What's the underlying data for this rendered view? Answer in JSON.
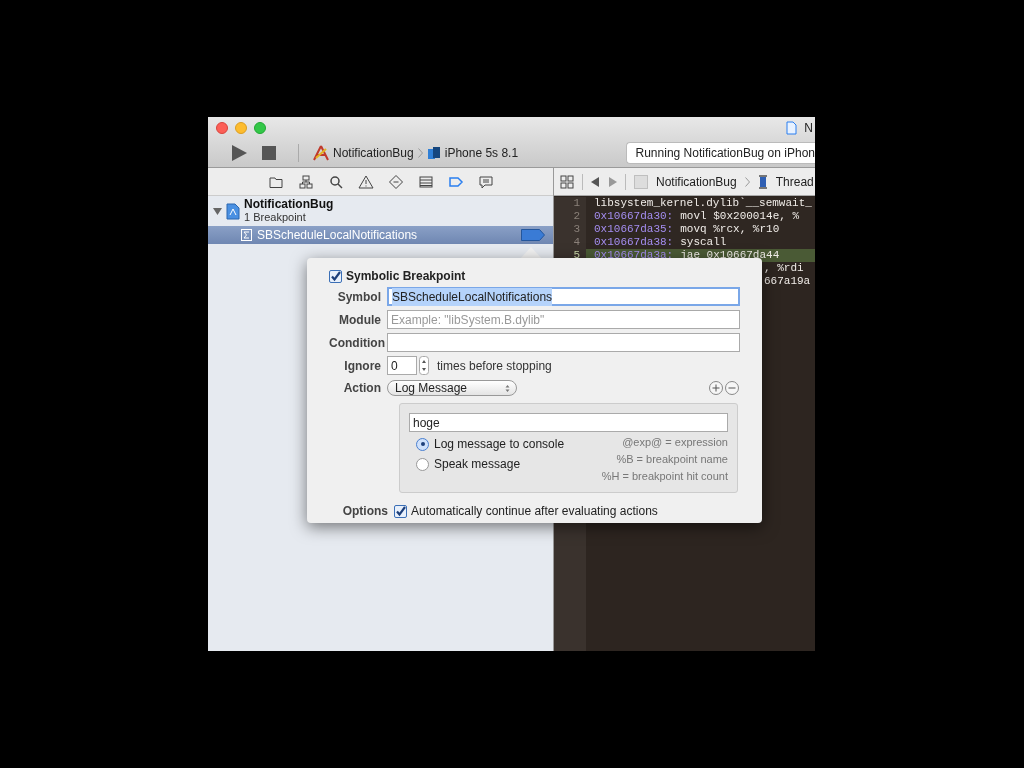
{
  "window": {
    "title": "N"
  },
  "toolbar": {
    "scheme": "NotificationBug",
    "destination": "iPhone 5s 8.1",
    "status": "Running NotificationBug on iPhon"
  },
  "navigator_tabs": [
    {
      "kind": "folder",
      "selected": false
    },
    {
      "kind": "hierarchy",
      "selected": false
    },
    {
      "kind": "search",
      "selected": false
    },
    {
      "kind": "warning",
      "selected": false
    },
    {
      "kind": "test",
      "selected": false
    },
    {
      "kind": "debug",
      "selected": false
    },
    {
      "kind": "breakpoint",
      "selected": true
    },
    {
      "kind": "log",
      "selected": false
    }
  ],
  "breakpoint_tree": [
    {
      "name": "NotificationBug",
      "subtitle": "1 Breakpoint",
      "expanded": true,
      "children": [
        {
          "name": "SBScheduleLocalNotifications",
          "selected": true,
          "enabled": true
        }
      ]
    }
  ],
  "jump_bar": [
    "NotificationBug",
    "Thread"
  ],
  "code_lines": [
    {
      "number": "1",
      "text": "libsystem_kernel.dylib`__semwait_",
      "current": false
    },
    {
      "number": "2",
      "address": "0x10667da30:",
      "text": "movl   $0x200014e, %",
      "current": false
    },
    {
      "number": "3",
      "address": "0x10667da35:",
      "text": "movq   %rcx, %r10",
      "current": false
    },
    {
      "number": "4",
      "address": "0x10667da38:",
      "text": "syscall",
      "current": false
    },
    {
      "number": "5",
      "address": "0x10667da3a:",
      "text": "jae    0x10667da44",
      "current": true
    }
  ],
  "code_fragments": [
    ", %rdi",
    "667a19a"
  ],
  "popover": {
    "enabled": true,
    "title": "Symbolic Breakpoint",
    "fields": [
      {
        "label": "Symbol",
        "value": "SBScheduleLocalNotifications",
        "focused": true
      },
      {
        "label": "Module",
        "placeholder": "Example: \"libSystem.B.dylib\"",
        "focused": false
      },
      {
        "label": "Condition",
        "focused": false
      }
    ],
    "ignore": {
      "label": "Ignore",
      "value": "0",
      "suffix": "times before stopping"
    },
    "action": {
      "label": "Action",
      "value": "Log Message",
      "message": "hoge",
      "outputs": [
        {
          "label": "Log message to console",
          "selected": true
        },
        {
          "label": "Speak message",
          "selected": false
        }
      ],
      "hints": [
        "@exp@ = expression",
        "%B = breakpoint name",
        "%H = breakpoint hit count"
      ]
    },
    "options": {
      "label": "Options",
      "text": "Automatically continue after evaluating actions",
      "checked": true
    }
  }
}
